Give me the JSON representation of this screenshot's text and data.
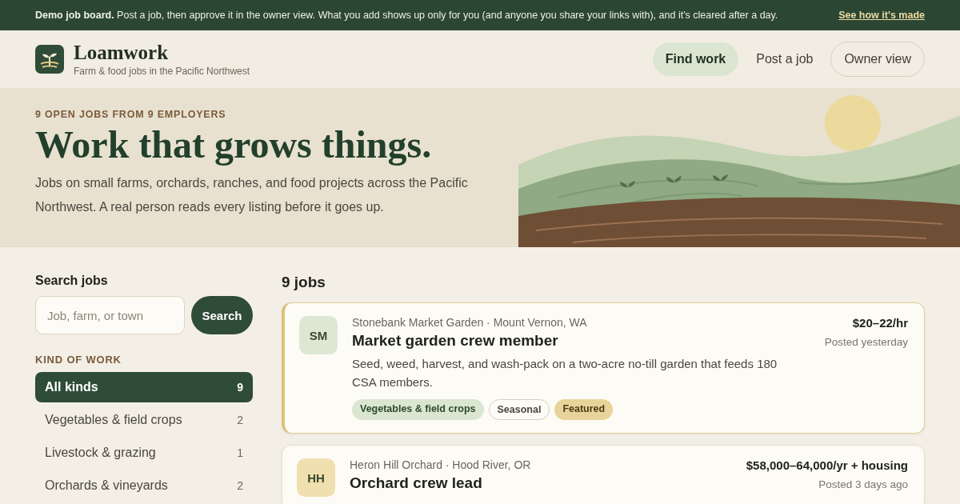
{
  "banner": {
    "text": "**Demo job board.** Post a job, then approve it in the owner view. What you add shows up only for you (and anyone you share your links with), and it's cleared after a day.",
    "link": "See how it's made"
  },
  "brand": {
    "name": "Loamwork",
    "tagline": "Farm & food jobs in the Pacific Northwest"
  },
  "nav": [
    {
      "label": "Find work",
      "selected": true,
      "kind": "plain"
    },
    {
      "label": "Post a job",
      "selected": false,
      "kind": "plain"
    },
    {
      "label": "Owner view",
      "selected": false,
      "kind": "outlined"
    }
  ],
  "hero": {
    "eyebrow": "9 OPEN JOBS FROM 9 EMPLOYERS",
    "title": "Work that grows things.",
    "text": "Jobs on small farms, orchards, ranches, and food projects across the Pacific Northwest. A real person reads every listing before it goes up."
  },
  "search": {
    "label": "Search jobs",
    "placeholder": "Job, farm, or town",
    "button": "Search"
  },
  "filter": {
    "heading": "KIND OF WORK",
    "items": [
      {
        "label": "All kinds",
        "count": "9",
        "selected": true
      },
      {
        "label": "Vegetables & field crops",
        "count": "2",
        "selected": false
      },
      {
        "label": "Livestock & grazing",
        "count": "1",
        "selected": false
      },
      {
        "label": "Orchards & vineyards",
        "count": "2",
        "selected": false
      }
    ]
  },
  "results": {
    "count": "9 jobs",
    "jobs": [
      {
        "initials": "SM",
        "color": "#dce8d4",
        "featured": true,
        "employer": "Stonebank Market Garden · Mount Vernon, WA",
        "title": "Market garden crew member",
        "description": "Seed, weed, harvest, and wash-pack on a two-acre no-till garden that feeds 180 CSA members.",
        "pay": "$20–22/hr",
        "posted": "Posted yesterday",
        "tags": [
          {
            "label": "Vegetables & field crops",
            "kind": "category"
          },
          {
            "label": "Seasonal",
            "kind": "outline"
          },
          {
            "label": "Featured",
            "kind": "featured"
          }
        ]
      },
      {
        "initials": "HH",
        "color": "#f0e0b0",
        "featured": false,
        "employer": "Heron Hill Orchard · Hood River, OR",
        "title": "Orchard crew lead",
        "pay": "$58,000–64,000/yr + housing",
        "posted": "Posted 3 days ago"
      }
    ]
  }
}
